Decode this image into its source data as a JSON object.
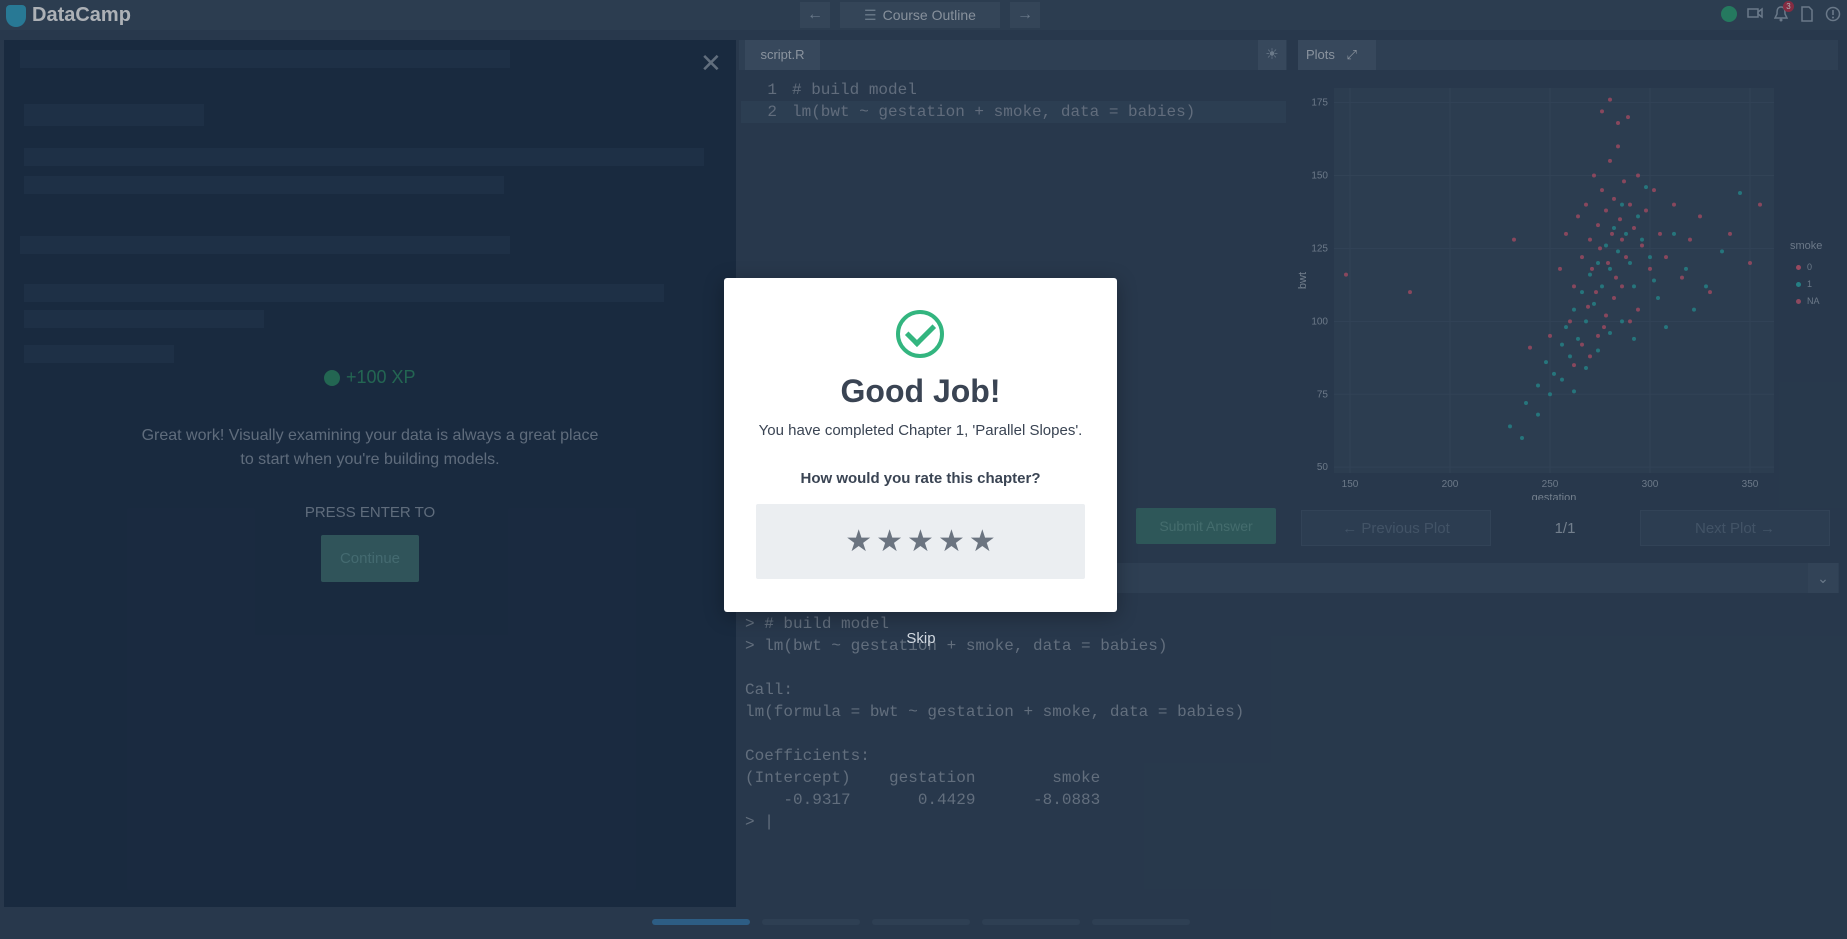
{
  "topbar": {
    "brand": "DataCamp",
    "outline_label": "Course Outline",
    "notification_count": "3"
  },
  "exercise": {
    "xp_label": "+100 XP",
    "feedback": "Great work! Visually examining your data is always a great place to start when you're building models.",
    "press_enter": "PRESS ENTER TO",
    "continue_label": "Continue"
  },
  "editor": {
    "tab_label": "script.R",
    "lines": [
      {
        "num": "1",
        "code": "# build model"
      },
      {
        "num": "2",
        "code": "lm(bwt ~ gestation + smoke, data = babies)"
      }
    ],
    "submit_label": "Submit Answer"
  },
  "plots": {
    "tab_label": "Plots",
    "prev_label": "← Previous Plot",
    "next_label": "Next Plot →",
    "pager": "1/1"
  },
  "chart_data": {
    "type": "scatter",
    "xlabel": "gestation",
    "ylabel": "bwt",
    "xlim": [
      142,
      362
    ],
    "ylim": [
      48,
      180
    ],
    "xticks": [
      "150",
      "200",
      "250",
      "300",
      "350"
    ],
    "yticks": [
      "50",
      "75",
      "100",
      "125",
      "150",
      "175"
    ],
    "legend": {
      "title": "smoke",
      "entries": [
        "0",
        "1",
        "NA"
      ]
    },
    "series_colors": {
      "0": "#e0607a",
      "1": "#2fb3b3",
      "NA": "#d0607a"
    },
    "series": [
      {
        "name": "0",
        "points": [
          [
            148,
            116
          ],
          [
            180,
            110
          ],
          [
            232,
            128
          ],
          [
            240,
            91
          ],
          [
            250,
            95
          ],
          [
            255,
            118
          ],
          [
            258,
            130
          ],
          [
            260,
            100
          ],
          [
            262,
            112
          ],
          [
            264,
            136
          ],
          [
            266,
            122
          ],
          [
            268,
            140
          ],
          [
            269,
            105
          ],
          [
            270,
            128
          ],
          [
            271,
            118
          ],
          [
            272,
            150
          ],
          [
            273,
            110
          ],
          [
            274,
            133
          ],
          [
            275,
            125
          ],
          [
            276,
            145
          ],
          [
            277,
            98
          ],
          [
            278,
            138
          ],
          [
            279,
            120
          ],
          [
            280,
            155
          ],
          [
            281,
            130
          ],
          [
            282,
            142
          ],
          [
            283,
            115
          ],
          [
            284,
            160
          ],
          [
            285,
            135
          ],
          [
            286,
            128
          ],
          [
            287,
            148
          ],
          [
            288,
            122
          ],
          [
            289,
            170
          ],
          [
            290,
            140
          ],
          [
            292,
            132
          ],
          [
            294,
            150
          ],
          [
            296,
            126
          ],
          [
            298,
            138
          ],
          [
            300,
            118
          ],
          [
            302,
            145
          ],
          [
            305,
            130
          ],
          [
            308,
            122
          ],
          [
            312,
            140
          ],
          [
            316,
            115
          ],
          [
            320,
            128
          ],
          [
            325,
            136
          ],
          [
            330,
            110
          ],
          [
            340,
            130
          ],
          [
            350,
            120
          ],
          [
            355,
            140
          ],
          [
            262,
            85
          ],
          [
            266,
            92
          ],
          [
            270,
            88
          ],
          [
            274,
            95
          ],
          [
            278,
            102
          ],
          [
            282,
            108
          ],
          [
            286,
            112
          ],
          [
            290,
            100
          ],
          [
            294,
            104
          ],
          [
            276,
            172
          ],
          [
            280,
            176
          ],
          [
            284,
            168
          ]
        ]
      },
      {
        "name": "1",
        "points": [
          [
            238,
            72
          ],
          [
            244,
            78
          ],
          [
            248,
            86
          ],
          [
            252,
            82
          ],
          [
            256,
            92
          ],
          [
            258,
            98
          ],
          [
            260,
            88
          ],
          [
            262,
            104
          ],
          [
            264,
            94
          ],
          [
            266,
            110
          ],
          [
            268,
            100
          ],
          [
            270,
            116
          ],
          [
            272,
            106
          ],
          [
            274,
            120
          ],
          [
            276,
            112
          ],
          [
            278,
            126
          ],
          [
            280,
            118
          ],
          [
            282,
            132
          ],
          [
            284,
            124
          ],
          [
            286,
            140
          ],
          [
            288,
            130
          ],
          [
            290,
            120
          ],
          [
            292,
            112
          ],
          [
            294,
            136
          ],
          [
            296,
            128
          ],
          [
            298,
            146
          ],
          [
            300,
            122
          ],
          [
            302,
            114
          ],
          [
            304,
            108
          ],
          [
            308,
            98
          ],
          [
            312,
            130
          ],
          [
            318,
            118
          ],
          [
            322,
            104
          ],
          [
            328,
            112
          ],
          [
            336,
            124
          ],
          [
            345,
            144
          ],
          [
            230,
            64
          ],
          [
            236,
            60
          ],
          [
            244,
            68
          ],
          [
            250,
            75
          ],
          [
            256,
            80
          ],
          [
            262,
            76
          ],
          [
            268,
            84
          ],
          [
            274,
            90
          ],
          [
            280,
            96
          ],
          [
            286,
            100
          ],
          [
            292,
            94
          ]
        ]
      }
    ]
  },
  "console": {
    "lines": [
      "> # build model",
      "> lm(bwt ~ gestation + smoke, data = babies)",
      "",
      "Call:",
      "lm(formula = bwt ~ gestation + smoke, data = babies)",
      "",
      "Coefficients:",
      "(Intercept)    gestation        smoke",
      "    -0.9317       0.4429      -8.0883",
      "> |"
    ]
  },
  "progress": {
    "completed_segments": 1,
    "total_segments": 5
  },
  "modal": {
    "title": "Good Job!",
    "subtitle": "You have completed Chapter 1, 'Parallel Slopes'.",
    "question": "How would you rate this chapter?",
    "star_count": 5,
    "skip_label": "Skip"
  }
}
